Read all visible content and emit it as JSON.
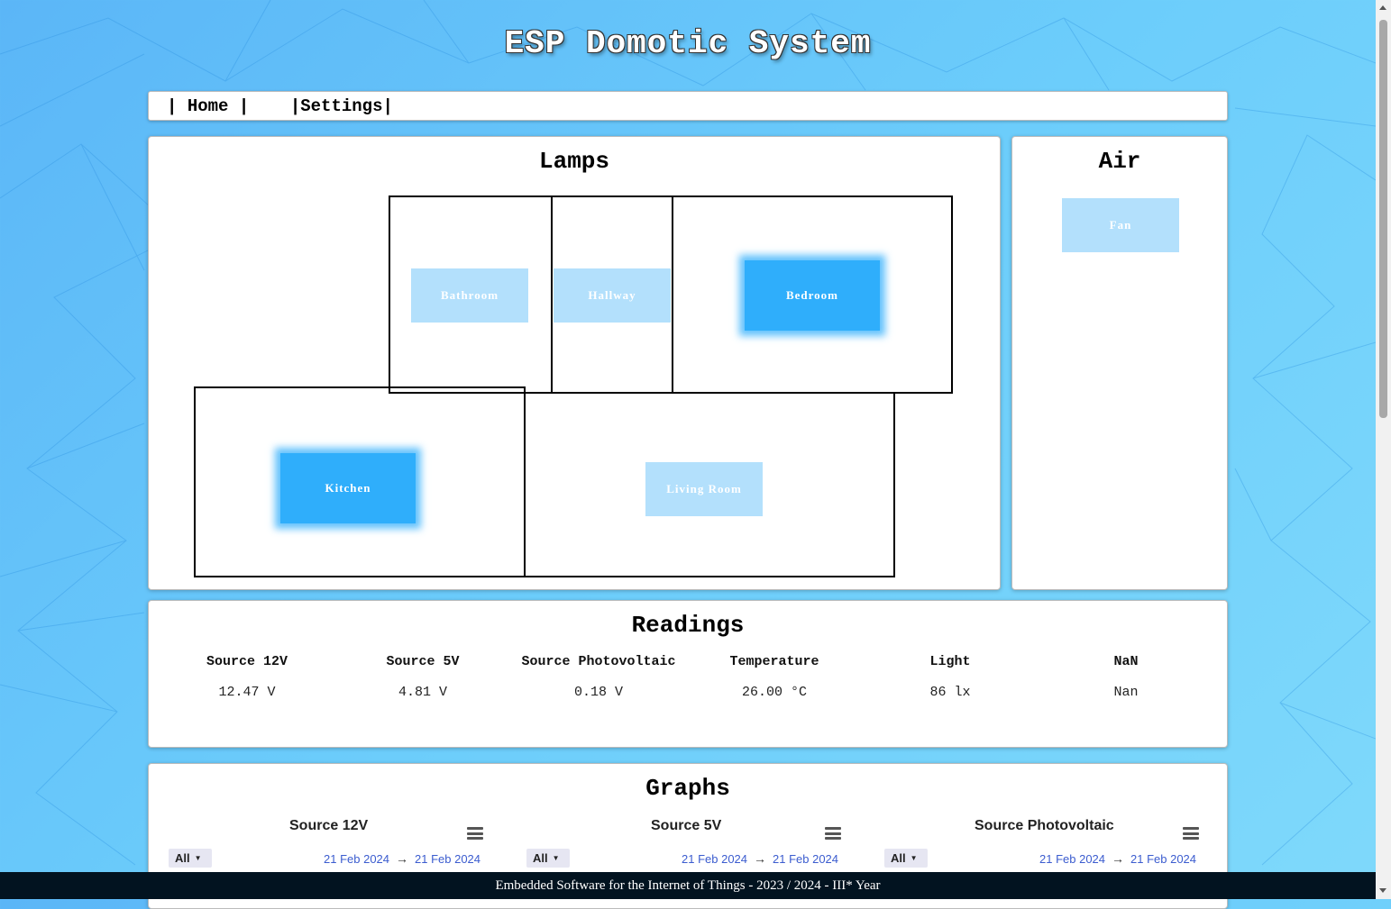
{
  "app_title": "ESP Domotic System",
  "nav": {
    "sep_left": "| ",
    "home": "Home",
    "sep_mid": " |    |",
    "settings": "Settings",
    "sep_right": "|"
  },
  "lamps": {
    "title": "Lamps",
    "rooms": {
      "bathroom": {
        "label": "Bathroom",
        "state": "off"
      },
      "hallway": {
        "label": "Hallway",
        "state": "off"
      },
      "bedroom": {
        "label": "Bedroom",
        "state": "on"
      },
      "kitchen": {
        "label": "Kitchen",
        "state": "on"
      },
      "living_room": {
        "label": "Living Room",
        "state": "off"
      }
    }
  },
  "air": {
    "title": "Air",
    "fan": {
      "label": "Fan",
      "state": "off"
    }
  },
  "readings": {
    "title": "Readings",
    "items": [
      {
        "label": "Source 12V",
        "value": "12.47 V"
      },
      {
        "label": "Source 5V",
        "value": "4.81 V"
      },
      {
        "label": "Source Photovoltaic",
        "value": "0.18 V"
      },
      {
        "label": "Temperature",
        "value": "26.00 °C"
      },
      {
        "label": "Light",
        "value": "86 lx"
      },
      {
        "label": "NaN",
        "value": "Nan"
      }
    ]
  },
  "graphs": {
    "title": "Graphs",
    "items": [
      {
        "title": "Source 12V",
        "range": "All",
        "from": "21 Feb 2024",
        "arrow": "→",
        "to": "21 Feb 2024"
      },
      {
        "title": "Source 5V",
        "range": "All",
        "from": "21 Feb 2024",
        "arrow": "→",
        "to": "21 Feb 2024"
      },
      {
        "title": "Source Photovoltaic",
        "range": "All",
        "from": "21 Feb 2024",
        "arrow": "→",
        "to": "21 Feb 2024"
      }
    ]
  },
  "footer": "Embedded Software for the Internet of Things - 2023 / 2024 - III* Year",
  "colors": {
    "lamp_on": "#2faefb",
    "lamp_off": "#b3e0fc",
    "footer_bg": "#021320",
    "date_link": "#3b5ccf"
  }
}
